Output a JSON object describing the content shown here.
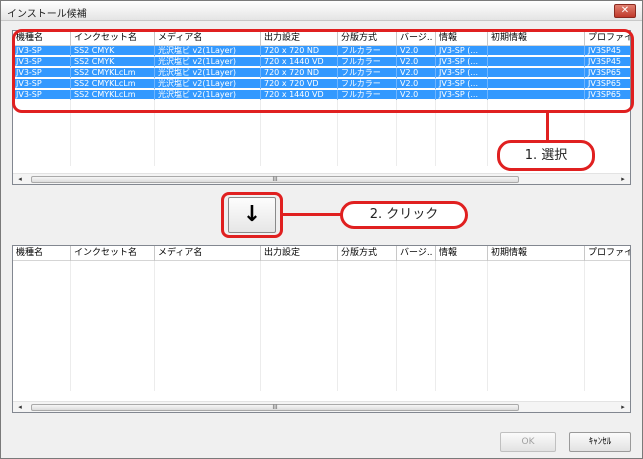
{
  "window": {
    "title": "インストール候補",
    "close_label": "✕"
  },
  "columns": [
    "機種名",
    "インクセット名",
    "メディア名",
    "出力設定",
    "分版方式",
    "バージ..",
    "情報",
    "初期情報",
    "プロファイ"
  ],
  "top_list": {
    "rows": [
      [
        "JV3-SP",
        "SS2 CMYK",
        "光沢塩ビ v2(1Layer)",
        "720 x 720 ND",
        "フルカラー",
        "V2.0",
        "JV3-SP (...",
        "",
        "JV3SP45"
      ],
      [
        "JV3-SP",
        "SS2 CMYK",
        "光沢塩ビ v2(1Layer)",
        "720 x 1440 VD",
        "フルカラー",
        "V2.0",
        "JV3-SP (...",
        "",
        "JV3SP45"
      ],
      [
        "JV3-SP",
        "SS2 CMYKLcLm",
        "光沢塩ビ v2(1Layer)",
        "720 x 720 ND",
        "フルカラー",
        "V2.0",
        "JV3-SP (...",
        "",
        "JV3SP65"
      ],
      [
        "JV3-SP",
        "SS2 CMYKLcLm",
        "光沢塩ビ v2(1Layer)",
        "720 x 720 VD",
        "フルカラー",
        "V2.0",
        "JV3-SP (...",
        "",
        "JV3SP65"
      ],
      [
        "JV3-SP",
        "SS2 CMYKLcLm",
        "光沢塩ビ v2(1Layer)",
        "720 x 1440 VD",
        "フルカラー",
        "V2.0",
        "JV3-SP (...",
        "",
        "JV3SP65"
      ]
    ]
  },
  "bottom_list": {
    "rows": []
  },
  "scrollbar": {
    "left_arrow": "◂",
    "right_arrow": "▸",
    "thumb_grip": "III"
  },
  "annotations": {
    "step1": "1. 選択",
    "step2": "2. クリック",
    "accent_color": "#e02020"
  },
  "move_button": {
    "icon": "down-arrow-icon",
    "glyph": "↓"
  },
  "buttons": {
    "ok": "OK",
    "cancel": "ｷｬﾝｾﾙ"
  },
  "colors": {
    "selection": "#3399ff",
    "annotation": "#e02020"
  }
}
